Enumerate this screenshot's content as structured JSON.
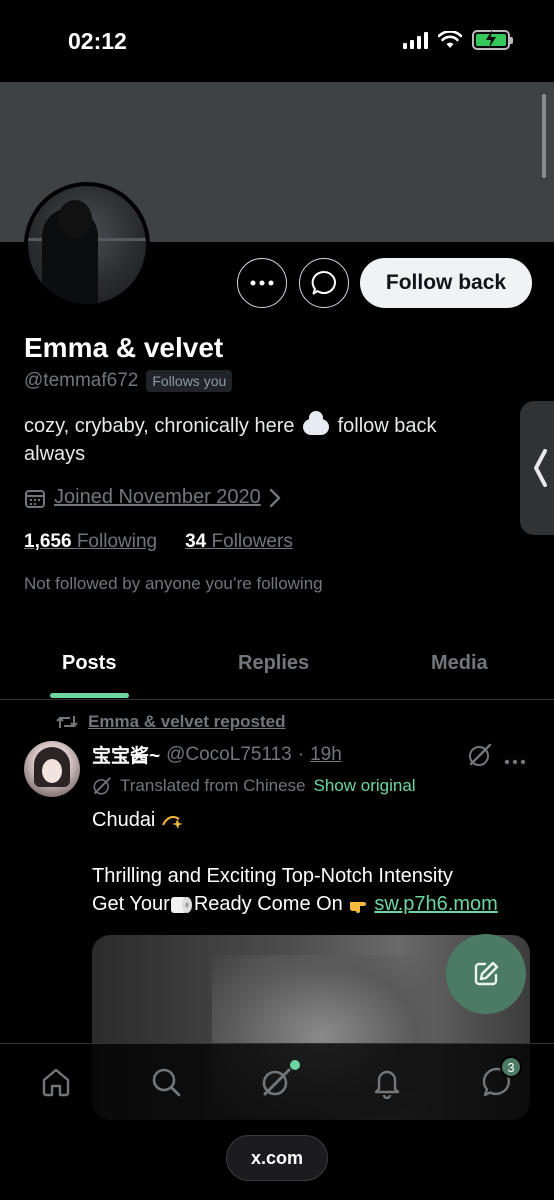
{
  "status_bar": {
    "time": "02:12"
  },
  "profile": {
    "display_name": "Emma & velvet",
    "handle": "@temmaf672",
    "follows_you_label": "Follows you",
    "bio_part1": "cozy, crybaby, chronically here",
    "bio_part2": "follow back always",
    "joined": "Joined November 2020",
    "following_count": "1,656",
    "following_label": "Following",
    "followers_count": "34",
    "followers_label": "Followers",
    "not_followed_note": "Not followed by anyone you’re following",
    "follow_back_label": "Follow back"
  },
  "tabs": [
    {
      "label": "Posts",
      "active": true
    },
    {
      "label": "Replies",
      "active": false
    },
    {
      "label": "Media",
      "active": false
    }
  ],
  "post": {
    "repost_by": "Emma & velvet reposted",
    "author_name": "宝宝酱~",
    "author_handle": "@CocoL75113",
    "separator": "·",
    "time": "19h",
    "translated_label": "Translated from Chinese",
    "show_original_label": "Show original",
    "line1": "Chudai",
    "line2": "Thrilling and Exciting Top-Notch Intensity",
    "line3_a": "Get Your",
    "line3_b": "Ready Come On",
    "link": "sw.p7h6.mom"
  },
  "nav": {
    "messages_badge": "3"
  },
  "browser": {
    "url": "x.com"
  },
  "colors": {
    "accent": "#6cd6a0",
    "fab": "#4b7a65",
    "banner": "#3e4245"
  },
  "icons": [
    "more-icon",
    "message-icon",
    "calendar-icon",
    "chevron-right-icon",
    "repost-icon",
    "grok-icon",
    "compose-icon",
    "home-icon",
    "search-icon",
    "bell-icon",
    "chat-icon"
  ]
}
